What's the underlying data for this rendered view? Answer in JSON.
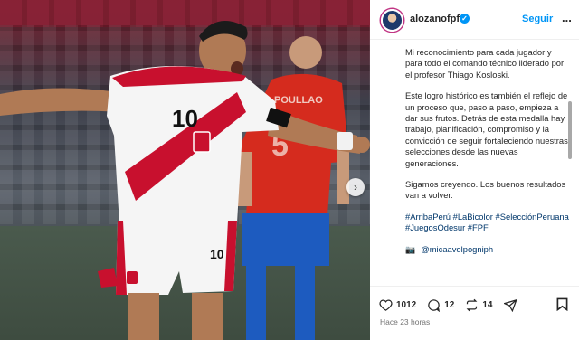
{
  "post": {
    "username": "alozanofpf",
    "follow_label": "Seguir",
    "more_label": "...",
    "caption": {
      "p1": "Mi reconocimiento para cada jugador y para todo el comando técnico liderado por el profesor Thiago Kosloski.",
      "p2": "Este logro histórico es también el reflejo de un proceso que, paso a paso, empieza a dar sus frutos. Detrás de esta medalla hay trabajo, planificación, compromiso y la convicción de seguir fortaleciendo nuestras selecciones desde las nuevas generaciones.",
      "p3": "Sigamos creyendo. Los buenos resultados van a volver.",
      "hashtags": "#ArribaPerú #LaBicolor #SelecciónPeruana #JuegosOdesur #FPF",
      "mention": "@micaavolpogniph"
    },
    "stats": {
      "likes": "1012",
      "comments": "12",
      "reposts": "14"
    },
    "timestamp": "Hace 23 horas"
  },
  "icons": {
    "verified": "verified-badge-icon",
    "next": "chevron-right-icon",
    "like": "heart-icon",
    "comment": "comment-icon",
    "repost": "repost-icon",
    "share": "send-icon",
    "save": "bookmark-icon",
    "camera": "camera-icon"
  },
  "colors": {
    "link": "#0095f6",
    "hashtag": "#00376b",
    "text": "#262626",
    "muted": "#737373",
    "peru_red": "#c8102e",
    "chile_red": "#d52b1e",
    "chile_blue": "#1d5bbf"
  }
}
